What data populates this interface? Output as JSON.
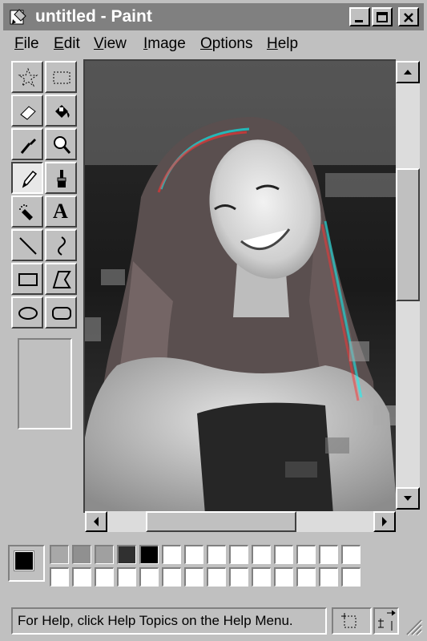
{
  "window": {
    "title": "untitled - Paint"
  },
  "menu": {
    "items": [
      {
        "label": "File",
        "u": "F",
        "rest": "ile"
      },
      {
        "label": "Edit",
        "u": "E",
        "rest": "dit"
      },
      {
        "label": "View",
        "u": "V",
        "rest": "iew"
      },
      {
        "label": "Image",
        "u": "I",
        "rest": "mage"
      },
      {
        "label": "Options",
        "u": "O",
        "rest": "ptions"
      },
      {
        "label": "Help",
        "u": "H",
        "rest": "elp"
      }
    ]
  },
  "tools": [
    {
      "name": "free-form-select",
      "icon": "star-select-icon"
    },
    {
      "name": "select",
      "icon": "rect-select-icon"
    },
    {
      "name": "eraser",
      "icon": "eraser-icon"
    },
    {
      "name": "fill",
      "icon": "fill-bucket-icon"
    },
    {
      "name": "pick-color",
      "icon": "eyedropper-icon"
    },
    {
      "name": "magnifier",
      "icon": "magnifier-icon"
    },
    {
      "name": "pencil",
      "icon": "pencil-icon",
      "active": true
    },
    {
      "name": "brush",
      "icon": "brush-icon"
    },
    {
      "name": "airbrush",
      "icon": "airbrush-icon"
    },
    {
      "name": "text",
      "icon": "text-icon",
      "glyph": "A"
    },
    {
      "name": "line",
      "icon": "line-icon"
    },
    {
      "name": "curve",
      "icon": "curve-icon"
    },
    {
      "name": "rectangle",
      "icon": "rectangle-icon"
    },
    {
      "name": "polygon",
      "icon": "polygon-icon"
    },
    {
      "name": "ellipse",
      "icon": "ellipse-icon"
    },
    {
      "name": "rounded-rectangle",
      "icon": "rounded-rect-icon"
    }
  ],
  "palette": {
    "foreground": "#000000",
    "background": "#ffffff",
    "top_row": [
      "#a8a8a8",
      "#909090",
      "#a0a0a0",
      "#303030",
      "#000000",
      "#ffffff",
      "#ffffff",
      "#ffffff",
      "#ffffff",
      "#ffffff",
      "#ffffff",
      "#ffffff",
      "#ffffff",
      "#ffffff"
    ],
    "bottom_row": [
      "#ffffff",
      "#ffffff",
      "#ffffff",
      "#ffffff",
      "#ffffff",
      "#ffffff",
      "#ffffff",
      "#ffffff",
      "#ffffff",
      "#ffffff",
      "#ffffff",
      "#ffffff",
      "#ffffff",
      "#ffffff"
    ]
  },
  "status": {
    "text": "For Help, click Help Topics on the Help Menu."
  },
  "scroll": {
    "vertical_position": 0.25,
    "horizontal_position": 0.2
  }
}
